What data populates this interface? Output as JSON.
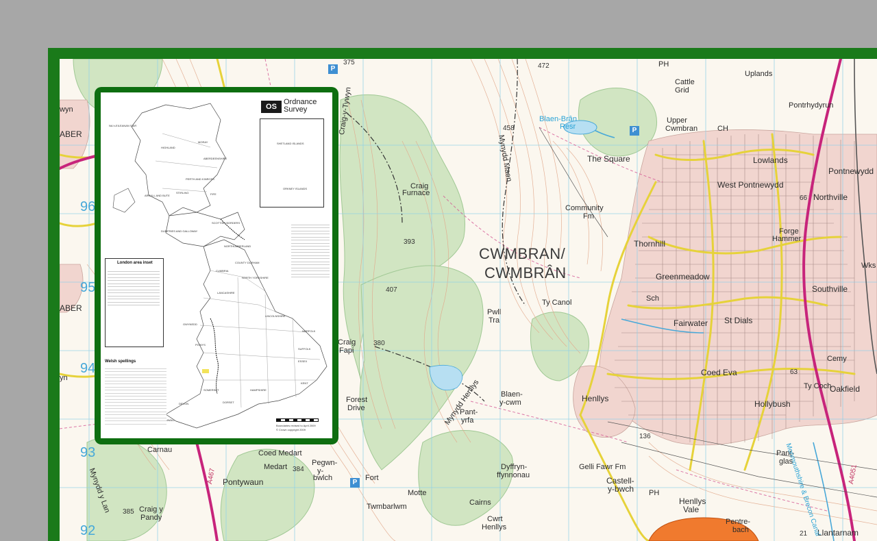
{
  "map": {
    "main_town": [
      "CWMBRAN/",
      "CWMBRÂN"
    ],
    "place_labels": [
      {
        "id": "uplands",
        "text": "Uplands"
      },
      {
        "id": "cattle-grid",
        "text": "Cattle"
      },
      {
        "id": "cattle-grid-2",
        "text": "Grid"
      },
      {
        "id": "pontrhydyrun",
        "text": "Pontrhydyrun"
      },
      {
        "id": "blaen-bran",
        "text": "Blaen-Brân"
      },
      {
        "id": "blaen-bran-2",
        "text": "Resr"
      },
      {
        "id": "upper-cwmbran",
        "text": "Upper"
      },
      {
        "id": "upper-cwmbran-2",
        "text": "Cwmbran"
      },
      {
        "id": "the-square",
        "text": "The Square"
      },
      {
        "id": "lowlands",
        "text": "Lowlands"
      },
      {
        "id": "pontnewydd",
        "text": "Pontnewydd"
      },
      {
        "id": "west-pontnewydd",
        "text": "West Pontnewydd"
      },
      {
        "id": "northville",
        "text": "Northville"
      },
      {
        "id": "community-fm",
        "text": "Community"
      },
      {
        "id": "community-fm-2",
        "text": "Fm"
      },
      {
        "id": "forge-hammer",
        "text": "Forge"
      },
      {
        "id": "forge-hammer-2",
        "text": "Hammer"
      },
      {
        "id": "thornhill",
        "text": "Thornhill"
      },
      {
        "id": "greenmeadow",
        "text": "Greenmeadow"
      },
      {
        "id": "southville",
        "text": "Southville"
      },
      {
        "id": "wks",
        "text": "Wks"
      },
      {
        "id": "sch",
        "text": "Sch"
      },
      {
        "id": "st-dials",
        "text": "St Dials"
      },
      {
        "id": "fairwater",
        "text": "Fairwater"
      },
      {
        "id": "ty-canol",
        "text": "Ty Canol"
      },
      {
        "id": "pwll-tra",
        "text": "Pwll"
      },
      {
        "id": "pwll-tra-2",
        "text": "Tra"
      },
      {
        "id": "craig-furnace",
        "text": "Craig"
      },
      {
        "id": "craig-furnace-2",
        "text": "Furnace"
      },
      {
        "id": "craig-fawr",
        "text": "Craig-y-Tywyn"
      },
      {
        "id": "craig-fapi",
        "text": "Craig"
      },
      {
        "id": "craig-fapi-2",
        "text": "Fapi"
      },
      {
        "id": "forest-drive",
        "text": "Forest"
      },
      {
        "id": "forest-drive-2",
        "text": "Drive"
      },
      {
        "id": "blaen-y-cwm",
        "text": "Blaen-"
      },
      {
        "id": "blaen-y-cwm-2",
        "text": "y-cwm"
      },
      {
        "id": "pant-yr-yrfa",
        "text": "Pant-"
      },
      {
        "id": "pant-yr-yrfa-2",
        "text": "yrfa"
      },
      {
        "id": "henllys",
        "text": "Henllys"
      },
      {
        "id": "coed-eva",
        "text": "Coed Eva"
      },
      {
        "id": "hollybush",
        "text": "Hollybush"
      },
      {
        "id": "ty-coch",
        "text": "Ty Coch"
      },
      {
        "id": "oakfield",
        "text": "Oakfield"
      },
      {
        "id": "cemy",
        "text": "Cemy"
      },
      {
        "id": "pant-glas",
        "text": "Pant-"
      },
      {
        "id": "pant-glas-2",
        "text": "glas"
      },
      {
        "id": "gelli-fawr",
        "text": "Gelli Fawr Fm"
      },
      {
        "id": "castell-y-bwch",
        "text": "Castell-"
      },
      {
        "id": "castell-y-bwch-2",
        "text": "y-bwch"
      },
      {
        "id": "dyffryn",
        "text": "Dyffryn-"
      },
      {
        "id": "dyffryn-2",
        "text": "ffynnonau"
      },
      {
        "id": "henllys-vale",
        "text": "Henllys"
      },
      {
        "id": "henllys-vale-2",
        "text": "Vale"
      },
      {
        "id": "pentre-bach",
        "text": "Pentre-"
      },
      {
        "id": "pentre-bach-2",
        "text": "bach"
      },
      {
        "id": "llantarnam",
        "text": "Llantarnam"
      },
      {
        "id": "cwrt-henllys",
        "text": "Cwrt"
      },
      {
        "id": "cwrt-henllys-2",
        "text": "Henllys"
      },
      {
        "id": "twmbarlwm",
        "text": "Twmbarlwm"
      },
      {
        "id": "pegwn-y-bwlch",
        "text": "Pegwn-"
      },
      {
        "id": "pegwn-y-bwlch-2",
        "text": "y-"
      },
      {
        "id": "pegwn-y-bwlch-3",
        "text": "bwlch"
      },
      {
        "id": "coed-medart",
        "text": "Coed Medart"
      },
      {
        "id": "medart",
        "text": "Medart"
      },
      {
        "id": "pontywaun",
        "text": "Pontywaun"
      },
      {
        "id": "craig-y-pandy",
        "text": "Craig y"
      },
      {
        "id": "craig-y-pandy-2",
        "text": "Pandy"
      },
      {
        "id": "carnau",
        "text": "Carnau"
      },
      {
        "id": "mynydd-y-lan",
        "text": "Mynydd y Lan"
      },
      {
        "id": "mynydd-maen",
        "text": "Mynydd Maen"
      },
      {
        "id": "mynydd-henllys",
        "text": "Mynydd Henllys"
      },
      {
        "id": "cairns",
        "text": "Cairns"
      },
      {
        "id": "fort",
        "text": "Fort"
      },
      {
        "id": "motte",
        "text": "Motte"
      },
      {
        "id": "aber-left",
        "text": "ABER"
      },
      {
        "id": "aber-left-2",
        "text": "ABER"
      },
      {
        "id": "wyn",
        "text": "wyn"
      },
      {
        "id": "yn",
        "text": "yn"
      },
      {
        "id": "ph1",
        "text": "PH"
      },
      {
        "id": "ph2",
        "text": "PH"
      },
      {
        "id": "ch",
        "text": "CH"
      },
      {
        "id": "canal",
        "text": "Monmouthshire & Brecon Canal"
      }
    ],
    "heights": [
      "375",
      "472",
      "458",
      "393",
      "407",
      "380",
      "384",
      "385",
      "136",
      "21",
      "63",
      "66"
    ],
    "grid_numbers": [
      "96",
      "95",
      "94",
      "93",
      "92"
    ],
    "road_numbers": [
      "A4051",
      "A467"
    ],
    "parking": "P"
  },
  "inset": {
    "logo_abbr": "OS",
    "logo_line1": "Ordnance",
    "logo_line2": "Survey",
    "london_heading": "London area inset",
    "welsh_heading": "Welsh spellings",
    "shetland_label": "SHETLAND ISLANDS",
    "orkney_label": "ORKNEY ISLANDS",
    "highland_label": "HIGHLAND",
    "na_h_eileanan_label": "NA h-EILEANAN SIAR",
    "moray_label": "MORAY",
    "aberdeenshire_label": "ABERDEENSHIRE",
    "perth_label": "PERTH AND KINROSS",
    "argyll_label": "ARGYLL AND BUTE",
    "stirling_label": "STIRLING",
    "fife_label": "FIFE",
    "scottish_borders_label": "SCOTTISH BORDERS",
    "dumfries_label": "DUMFRIES AND GALLOWAY",
    "northumberland_label": "NORTHUMBERLAND",
    "cumbria_label": "CUMBRIA",
    "county_durham_label": "COUNTY DURHAM",
    "north_yorkshire_label": "NORTH YORKSHIRE",
    "lancashire_label": "LANCASHIRE",
    "lincolnshire_label": "LINCOLNSHIRE",
    "norfolk_label": "NORFOLK",
    "suffolk_label": "SUFFOLK",
    "essex_label": "ESSEX",
    "kent_label": "KENT",
    "devon_label": "DEVON",
    "cornwall_label": "CORNWALL",
    "dorset_label": "DORSET",
    "somerset_label": "SOMERSET",
    "hampshire_label": "HAMPSHIRE",
    "powys_label": "POWYS",
    "gwynedd_label": "GWYNEDD",
    "boundaries_note": "Boundaries revised to April 2009",
    "copyright": "© Crown copyright 2009"
  }
}
